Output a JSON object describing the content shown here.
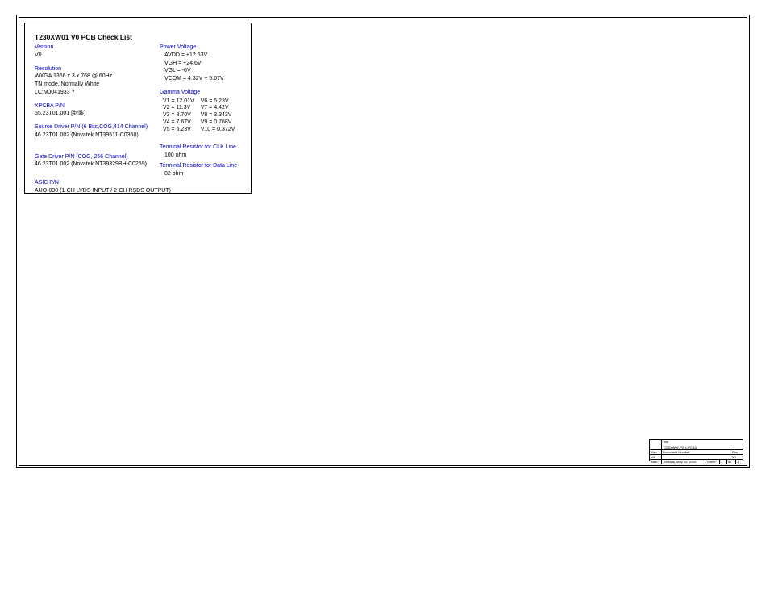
{
  "title": "T230XW01 V0 PCB Check List",
  "left": {
    "version": {
      "label": "Version",
      "value": "V0"
    },
    "resolution": {
      "label": "Resolution",
      "lines": [
        "WXGA 1366 x 3 x 768 @ 60Hz",
        "TN mode, Normally White",
        "LC:MJ041933 ?"
      ]
    },
    "xpcba": {
      "label": "XPCBA P/N",
      "value": "55.23T01.001 [封裝]"
    },
    "source_driver": {
      "label": "Source Driver P/N   (6 Bits,COG,414 Channel)",
      "value": "46.23T01.002 (Novatek NT39511-C0360)"
    },
    "gate_driver": {
      "label": "Gate Driver P/N   (COG, 256 Channel)",
      "value": "46.23T01.002 (Novatek NT39329BH-C0259)"
    },
    "asic": {
      "label": "ASIC P/N",
      "value": "AUO-030  (1-CH LVDS INPUT / 2-CH RSDS OUTPUT)"
    }
  },
  "right": {
    "power": {
      "label": "Power Voltage",
      "lines": [
        "AVDD = +12.63V",
        "VGH = +24.6V",
        "VGL = -6V",
        "VCOM = 4.32V ~ 5.67V"
      ]
    },
    "gamma": {
      "label": "Gamma Voltage",
      "col1": [
        "V1 = 12.01V",
        "V2 = 11.3V",
        "V3 = 8.70V",
        "V4 = 7.67V",
        "V5 = 6.23V"
      ],
      "col2": [
        "V6 = 5.23V",
        "V7 = 4.42V",
        "V8 = 3.343V",
        "V9 = 0.768V",
        "V10 = 0.372V"
      ]
    },
    "term_clk": {
      "label": "Terminal Resistor for CLK Line",
      "value": "100 ohm"
    },
    "term_data": {
      "label": "Terminal Resistor for Data Line",
      "value": "82 ohm"
    }
  },
  "titleblock": {
    "r1": "Title",
    "r2": "T230XW01 V0 X-PCBA",
    "r3a": "Size",
    "r3b": "Document Number",
    "r3c": "Rev",
    "r4a": "A3",
    "r4b": "",
    "r4c": "V0",
    "r5a": "Date:",
    "r5b": "Tuesday, May 10, 2005",
    "r5c": "Sheet",
    "r5d": "1",
    "r5e": "of",
    "r5f": "1"
  }
}
